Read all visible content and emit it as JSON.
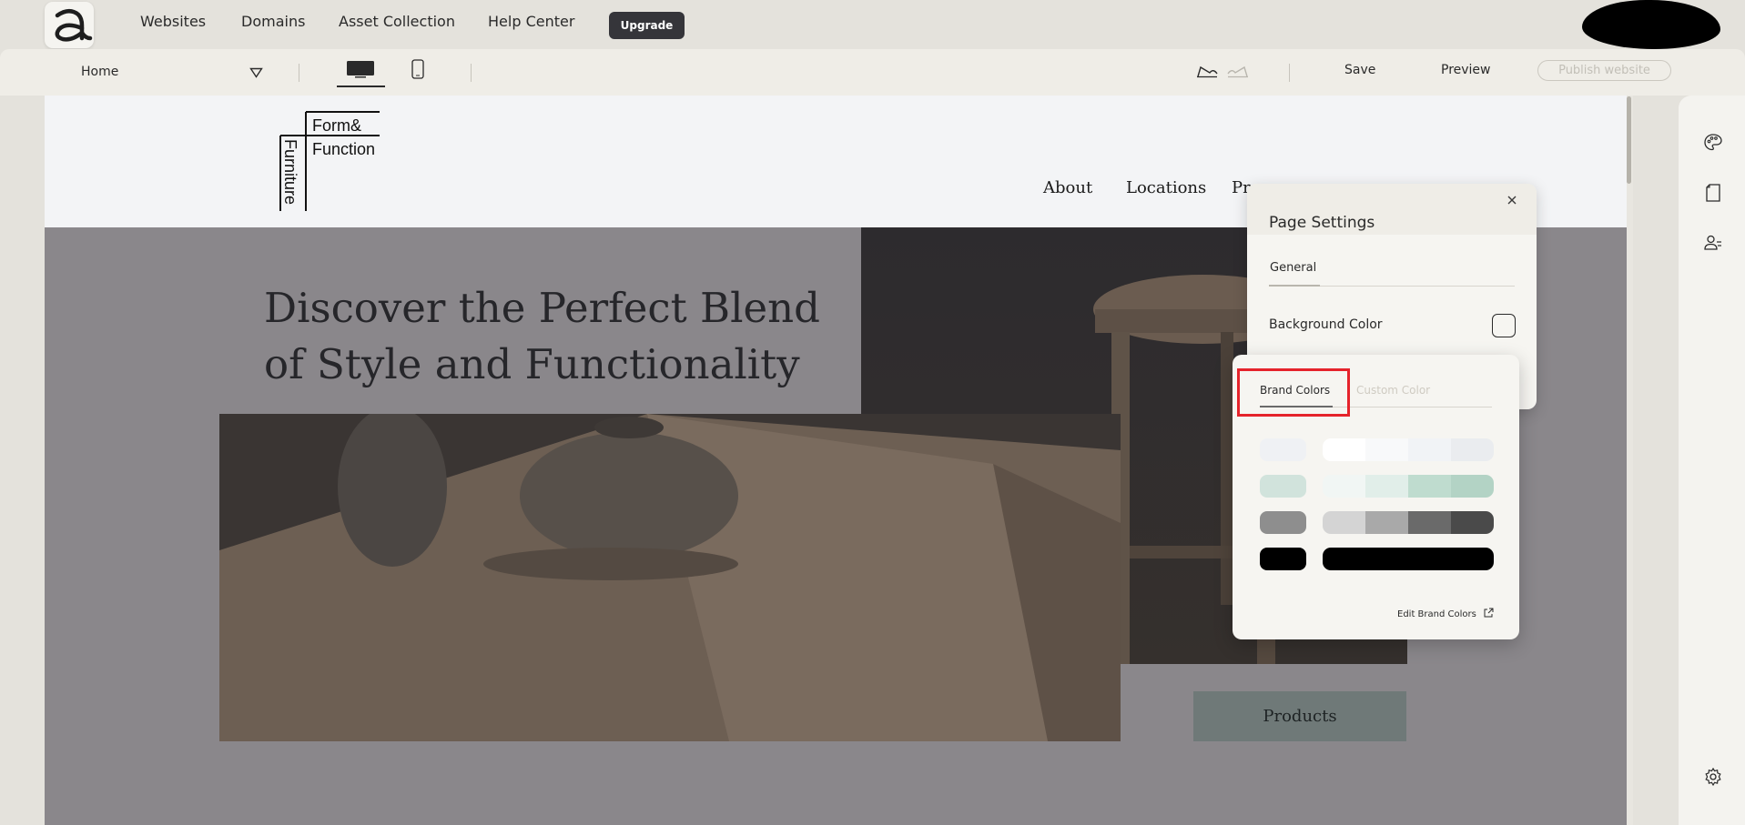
{
  "topnav": {
    "links": [
      "Websites",
      "Domains",
      "Asset Collection",
      "Help Center"
    ],
    "upgrade_label": "Upgrade"
  },
  "toolbar": {
    "page_select": "Home",
    "save_label": "Save",
    "preview_label": "Preview",
    "publish_label": "Publish website"
  },
  "site": {
    "logo_lines": [
      "Form&",
      "Function",
      "Furniture"
    ],
    "nav": [
      "About",
      "Locations",
      "Pr"
    ],
    "hero_title_line1": "Discover the Perfect Blend",
    "hero_title_line2": "of Style and Functionality",
    "products_button": "Products"
  },
  "page_settings": {
    "title": "Page Settings",
    "tab_general": "General",
    "background_color_label": "Background Color"
  },
  "color_picker": {
    "tab_brand": "Brand Colors",
    "tab_custom": "Custom Color",
    "edit_brand_colors": "Edit Brand Colors",
    "swatches": [
      {
        "main": "#eff1f4",
        "shades": [
          "#ffffff",
          "#f8f9fa",
          "#f1f3f6",
          "#eaecef"
        ]
      },
      {
        "main": "#d1e3dc",
        "shades": [
          "#f1f6f4",
          "#e1eee9",
          "#bfdccf",
          "#b3d3c5"
        ]
      },
      {
        "main": "#8e8e8e",
        "shades": [
          "#d4d4d4",
          "#a9a9a9",
          "#6a6a6a",
          "#4a4a4a"
        ]
      },
      {
        "main": "#000000",
        "shades": [
          "#000000",
          "#000000",
          "#000000",
          "#000000"
        ]
      }
    ]
  }
}
